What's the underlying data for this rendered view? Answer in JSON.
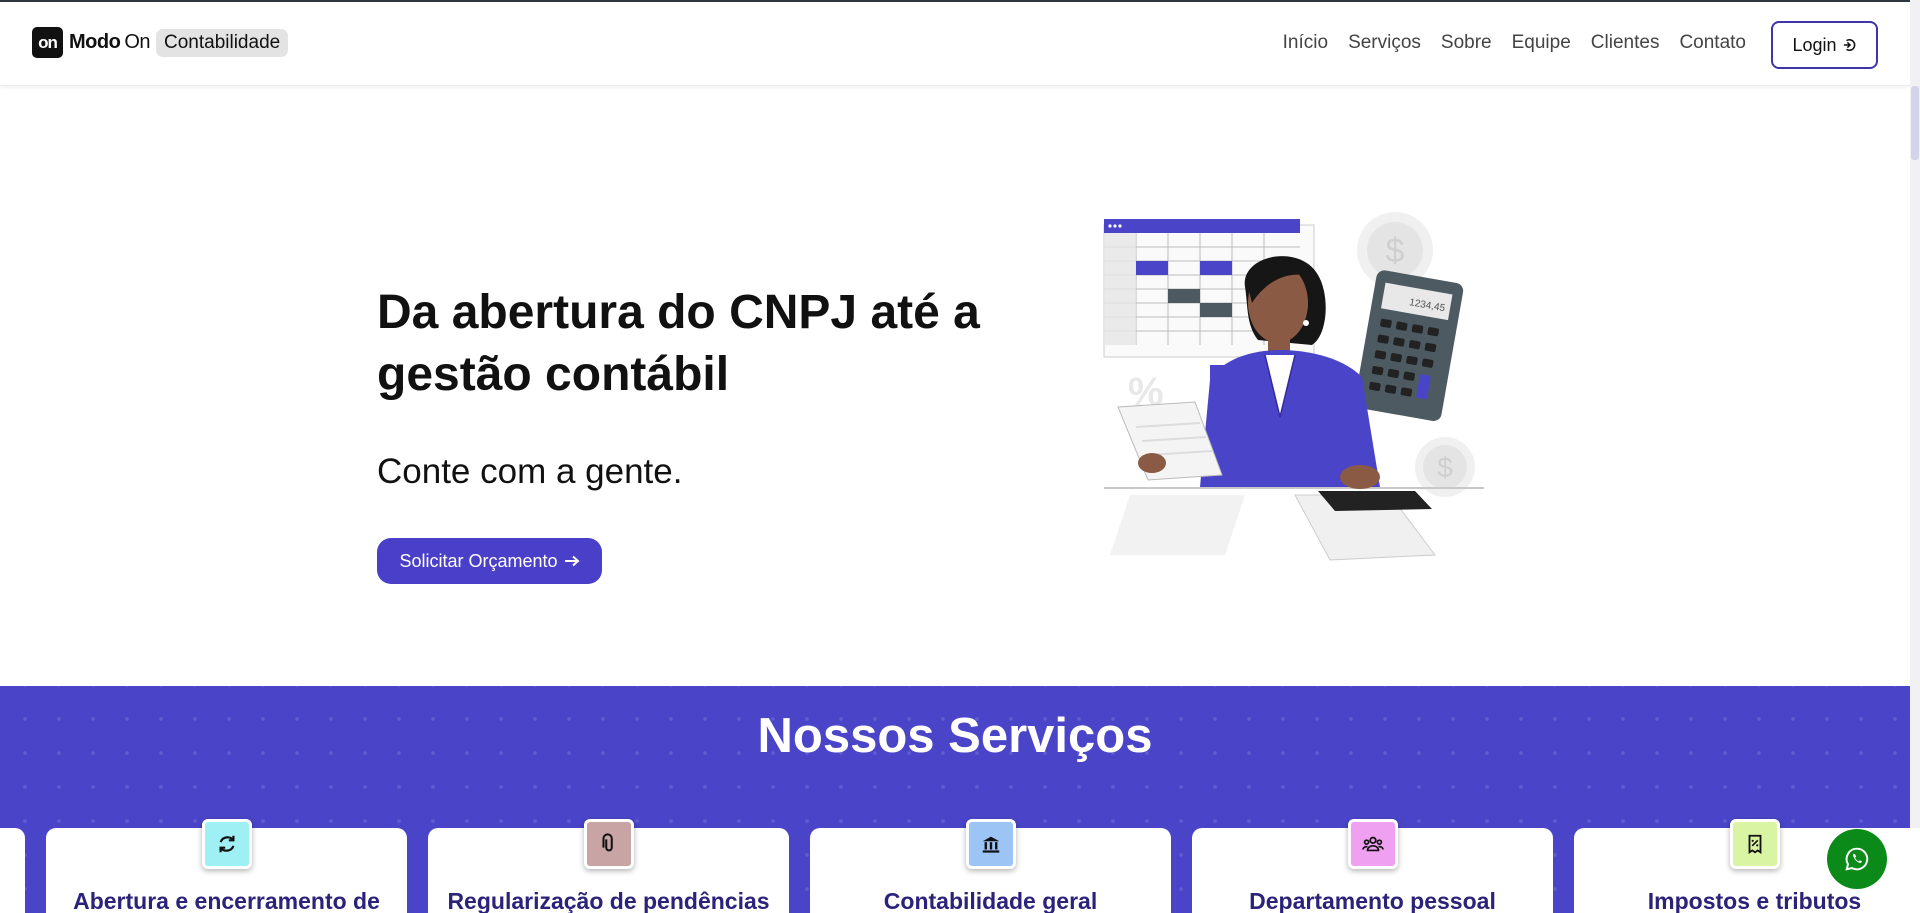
{
  "brand": {
    "badge": "on",
    "name_bold": "Modo",
    "name_light": "On",
    "tag": "Contabilidade"
  },
  "nav": {
    "items": [
      "Início",
      "Serviços",
      "Sobre",
      "Equipe",
      "Clientes",
      "Contato"
    ],
    "login_label": "Login"
  },
  "hero": {
    "title": "Da abertura do CNPJ até a gestão contábil",
    "subtitle": "Conte com a gente.",
    "cta_label": "Solicitar Orçamento"
  },
  "illustration": {
    "calculator_display": "1234,45",
    "percent_symbol": "%",
    "dollar_symbol": "$"
  },
  "services": {
    "title": "Nossos Serviços",
    "cards": [
      {
        "title": "Abertura e encerramento de",
        "icon": "refresh-icon",
        "color": "#9ff0f5"
      },
      {
        "title": "Regularização de pendências",
        "icon": "paperclip-icon",
        "color": "#c8a4a4"
      },
      {
        "title": "Contabilidade geral",
        "icon": "bank-icon",
        "color": "#9cc4f5"
      },
      {
        "title": "Departamento pessoal",
        "icon": "people-icon",
        "color": "#f0a0f0"
      },
      {
        "title": "Impostos e tributos",
        "icon": "receipt-icon",
        "color": "#d9f5a4"
      }
    ]
  },
  "colors": {
    "primary": "#4a45c8",
    "cta": "#4a3fc8",
    "card_title": "#2b237a",
    "whatsapp": "#0b8a19"
  }
}
